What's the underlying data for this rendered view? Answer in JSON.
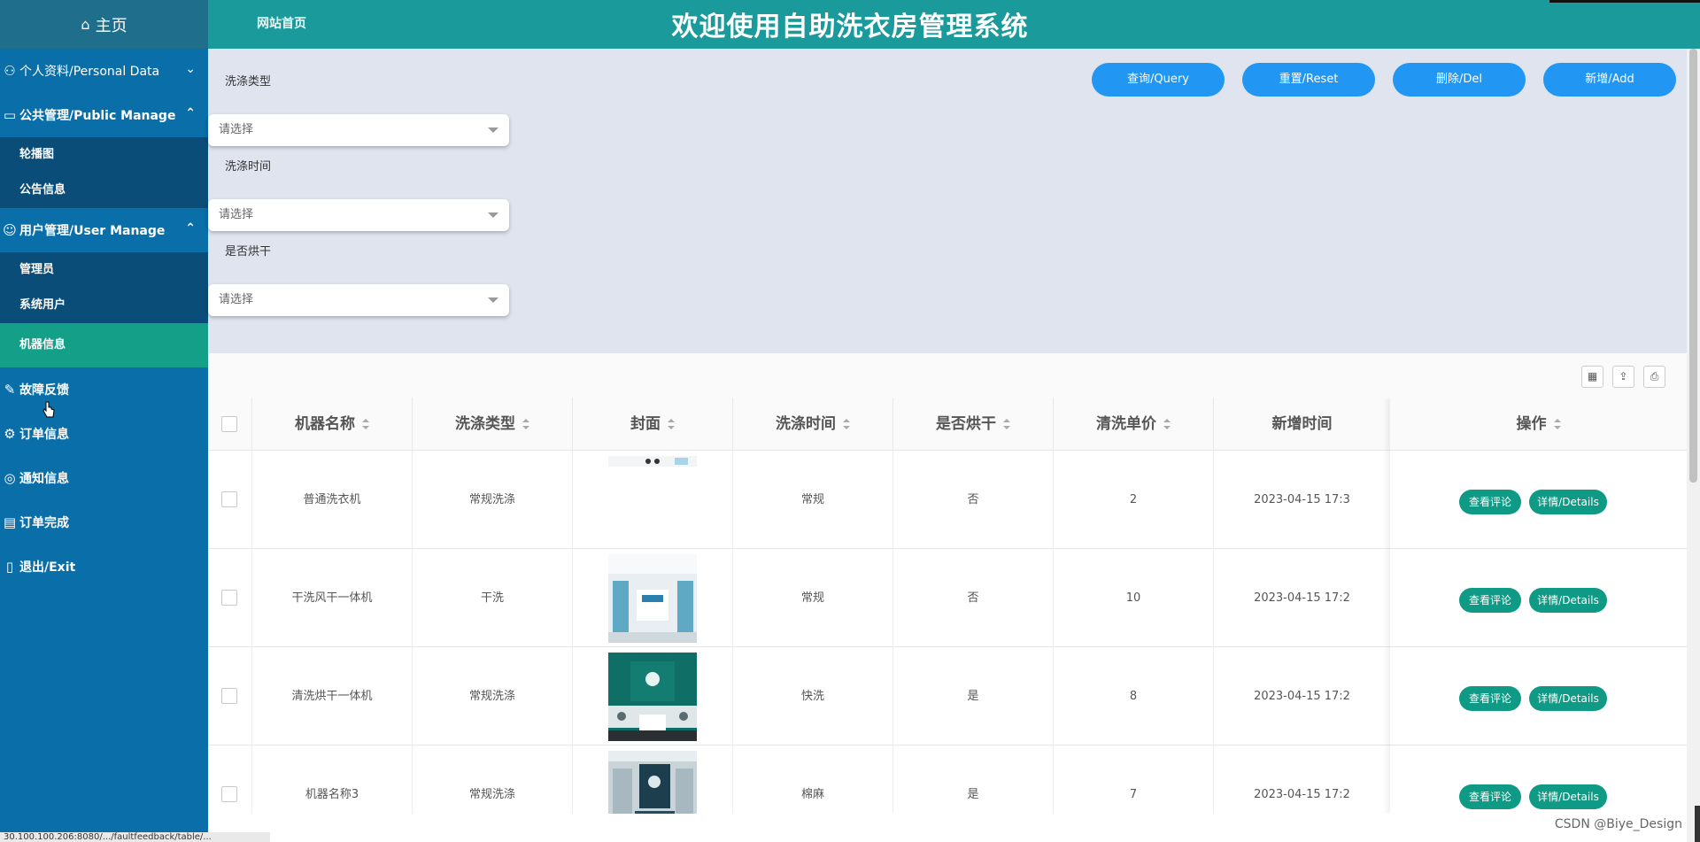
{
  "header": {
    "home_label": "主页",
    "site_link": "网站首页",
    "title": "欢迎使用自助洗衣房管理系统"
  },
  "sidebar": {
    "groups": [
      {
        "label": "个人资料/Personal Data",
        "icon": "person-icon"
      },
      {
        "label": "公共管理/Public Manage",
        "icon": "monitor-icon",
        "items": [
          "轮播图",
          "公告信息"
        ]
      },
      {
        "label": "用户管理/User Manage",
        "icon": "user-icon",
        "items": [
          "管理员",
          "系统用户",
          "机器信息"
        ]
      }
    ],
    "active_item": "机器信息",
    "plain_items": [
      {
        "label": "故障反馈",
        "icon": "tool-icon"
      },
      {
        "label": "订单信息",
        "icon": "gear-icon"
      },
      {
        "label": "通知信息",
        "icon": "bell-icon"
      },
      {
        "label": "订单完成",
        "icon": "clipboard-icon"
      },
      {
        "label": "退出/Exit",
        "icon": "exit-icon"
      }
    ]
  },
  "filters": {
    "wash_type_label": "洗涤类型",
    "wash_time_label": "洗涤时间",
    "dry_label": "是否烘干",
    "placeholder": "请选择"
  },
  "buttons": {
    "query": "查询/Query",
    "reset": "重置/Reset",
    "delete": "删除/Del",
    "add": "新增/Add"
  },
  "table": {
    "columns": [
      "机器名称",
      "洗涤类型",
      "封面",
      "洗涤时间",
      "是否烘干",
      "清洗单价",
      "新增时间",
      "操作"
    ],
    "rows": [
      {
        "name": "普通洗衣机",
        "type": "常规洗涤",
        "time": "常规",
        "dry": "否",
        "price": "2",
        "created": "2023-04-15 17:3"
      },
      {
        "name": "干洗风干一体机",
        "type": "干洗",
        "time": "常规",
        "dry": "否",
        "price": "10",
        "created": "2023-04-15 17:2"
      },
      {
        "name": "清洗烘干一体机",
        "type": "常规洗涤",
        "time": "快洗",
        "dry": "是",
        "price": "8",
        "created": "2023-04-15 17:2"
      },
      {
        "name": "机器名称3",
        "type": "常规洗涤",
        "time": "棉麻",
        "dry": "是",
        "price": "7",
        "created": "2023-04-15 17:2"
      }
    ],
    "actions": {
      "comments": "查看评论",
      "details": "详情/Details"
    }
  },
  "status_url": "30.100.100.206:8080/.../faultfeedback/table/...",
  "watermark": "CSDN @Biye_Design",
  "colors": {
    "header": "#1a9a9b",
    "sidebar": "#0a6ea8",
    "sidebar_sub": "#0a4d78",
    "active": "#14a088",
    "button": "#2196f3",
    "action_pill": "#0e9a84"
  }
}
